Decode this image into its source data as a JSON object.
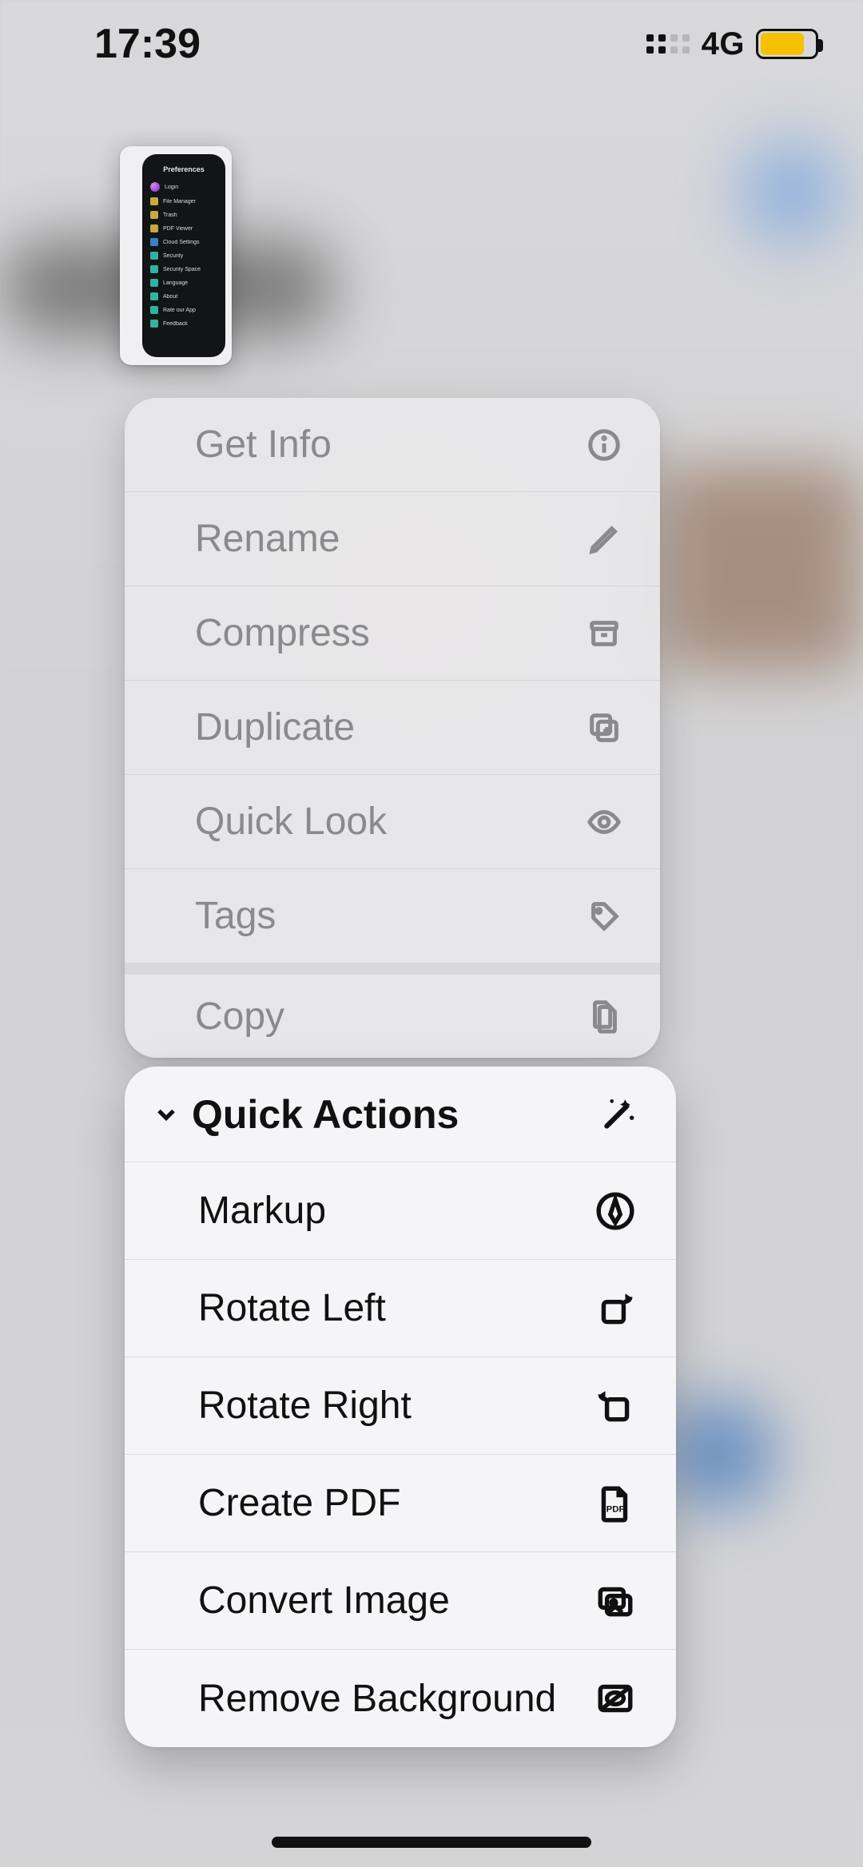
{
  "status_bar": {
    "time": "17:39",
    "network": "4G",
    "battery_level_pct": 70,
    "battery_color": "#f6c100",
    "signal_bars_active": 2,
    "signal_bars_total": 4
  },
  "preview_thumbnail": {
    "title": "Preferences",
    "rows": [
      "Login",
      "File Manager",
      "Trash",
      "PDF Viewer",
      "Cloud Settings",
      "Security",
      "Security Space",
      "Language",
      "About",
      "Rate our App",
      "Feedback"
    ]
  },
  "menu1": {
    "items": {
      "getinfo": "Get Info",
      "rename": "Rename",
      "compress": "Compress",
      "duplicate": "Duplicate",
      "quicklook": "Quick Look",
      "tags": "Tags",
      "copy": "Copy"
    }
  },
  "menu2": {
    "title": "Quick Actions",
    "items": {
      "markup": "Markup",
      "rotleft": "Rotate Left",
      "rotright": "Rotate Right",
      "createpdf": "Create PDF",
      "convert": "Convert Image",
      "removebg": "Remove Background"
    }
  },
  "highlight": "createpdf"
}
